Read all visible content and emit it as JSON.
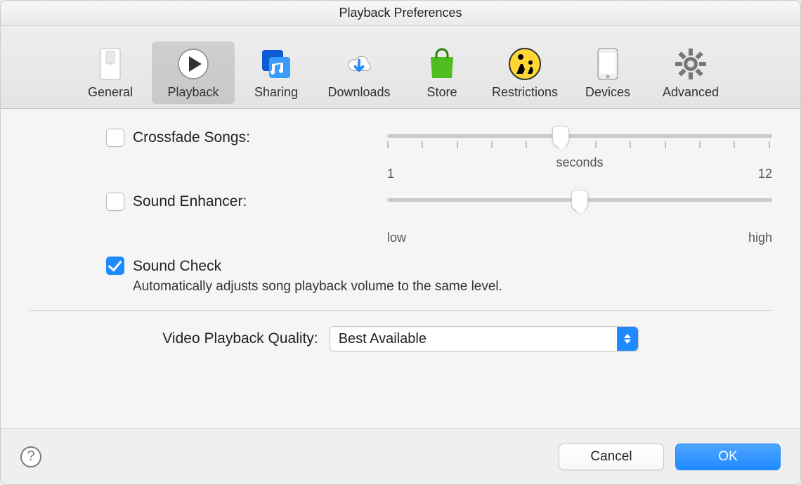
{
  "window": {
    "title": "Playback Preferences"
  },
  "toolbar": {
    "items": [
      {
        "label": "General"
      },
      {
        "label": "Playback"
      },
      {
        "label": "Sharing"
      },
      {
        "label": "Downloads"
      },
      {
        "label": "Store"
      },
      {
        "label": "Restrictions"
      },
      {
        "label": "Devices"
      },
      {
        "label": "Advanced"
      }
    ],
    "selected_index": 1
  },
  "options": {
    "crossfade": {
      "label": "Crossfade Songs:",
      "checked": false,
      "min_label": "1",
      "max_label": "12",
      "center_label": "seconds",
      "value": 6,
      "min": 1,
      "max": 12
    },
    "enhancer": {
      "label": "Sound Enhancer:",
      "checked": false,
      "min_label": "low",
      "max_label": "high",
      "value": 55,
      "min": 0,
      "max": 100
    },
    "sound_check": {
      "label": "Sound Check",
      "checked": true,
      "description": "Automatically adjusts song playback volume to the same level."
    }
  },
  "video_quality": {
    "label": "Video Playback Quality:",
    "selected": "Best Available"
  },
  "footer": {
    "help_symbol": "?",
    "cancel": "Cancel",
    "ok": "OK"
  }
}
